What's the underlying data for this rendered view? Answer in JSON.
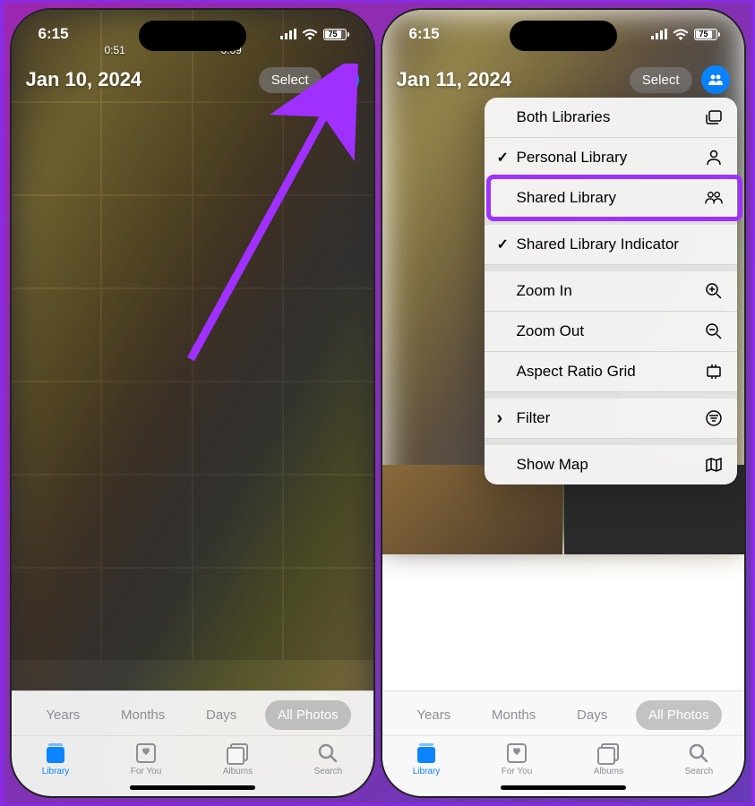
{
  "left": {
    "status": {
      "time": "6:15",
      "battery": "75"
    },
    "date": "Jan 10, 2024",
    "select_label": "Select",
    "durations": [
      "0:51",
      "0:09"
    ]
  },
  "right": {
    "status": {
      "time": "6:15",
      "battery": "75"
    },
    "date": "Jan 11, 2024",
    "select_label": "Select",
    "popover": {
      "both": "Both Libraries",
      "personal": "Personal Library",
      "shared": "Shared Library",
      "indicator": "Shared Library Indicator",
      "zoom_in": "Zoom In",
      "zoom_out": "Zoom Out",
      "aspect": "Aspect Ratio Grid",
      "filter": "Filter",
      "show_map": "Show Map"
    }
  },
  "segmented": {
    "years": "Years",
    "months": "Months",
    "days": "Days",
    "all": "All Photos"
  },
  "tabs": {
    "library": "Library",
    "foryou": "For You",
    "albums": "Albums",
    "search": "Search"
  }
}
